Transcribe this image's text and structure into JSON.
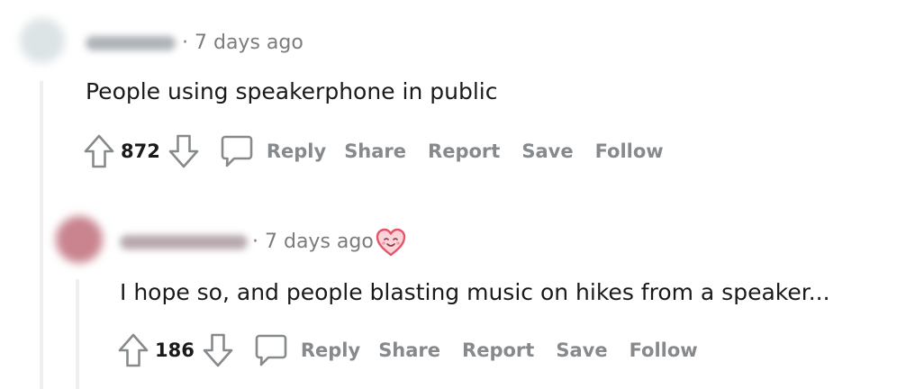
{
  "comments": [
    {
      "timestamp": "7 days ago",
      "separator": "·",
      "body": "People using speakerphone in public",
      "score": "872",
      "actions": {
        "reply": "Reply",
        "share": "Share",
        "report": "Report",
        "save": "Save",
        "follow": "Follow"
      },
      "avatar_color": "#dde4e6"
    },
    {
      "timestamp": "7 days ago",
      "separator": "·",
      "body": "I hope so, and people blasting music on hikes from a speaker...",
      "score": "186",
      "actions": {
        "reply": "Reply",
        "share": "Share",
        "report": "Report",
        "save": "Save",
        "follow": "Follow"
      },
      "avatar_color": "#c9848f",
      "flair_icon": "heart-face-icon"
    }
  ],
  "colors": {
    "text_primary": "#1a1a1b",
    "text_secondary": "#878a8c",
    "meta": "#7c7c7c",
    "thread_line": "#edeff1",
    "heart": "#e4546a"
  }
}
